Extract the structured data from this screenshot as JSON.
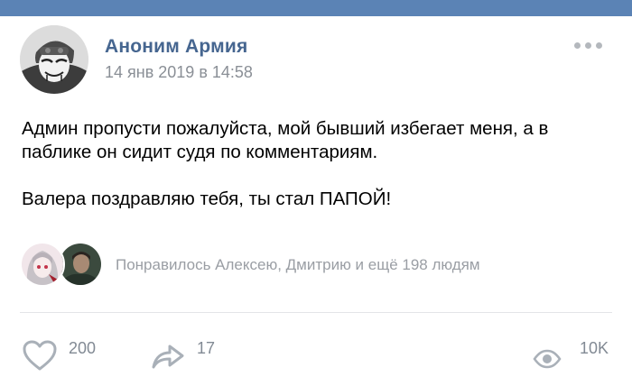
{
  "post": {
    "author": "Аноним Армия",
    "timestamp": "14 янв 2019 в 14:58",
    "text_line_1": "Админ пропусти пожалуйста, мой бывший избегает меня, а в паблике он сидит судя по комментариям.",
    "text_line_2": "Валера поздравляю тебя, ты стал ПАПОЙ!",
    "liked_by": "Понравилось Алексею, Дмитрию и ещё 198 людям"
  },
  "actions": {
    "likes": "200",
    "shares": "17",
    "views": "10K"
  },
  "icons": {
    "more": "more-dots-icon",
    "like": "heart-icon",
    "share": "share-arrow-icon",
    "views": "eye-icon"
  },
  "colors": {
    "topbar": "#5b83b5",
    "author": "#466690",
    "muted": "#8a8f96",
    "icon": "#a9b0b8"
  }
}
